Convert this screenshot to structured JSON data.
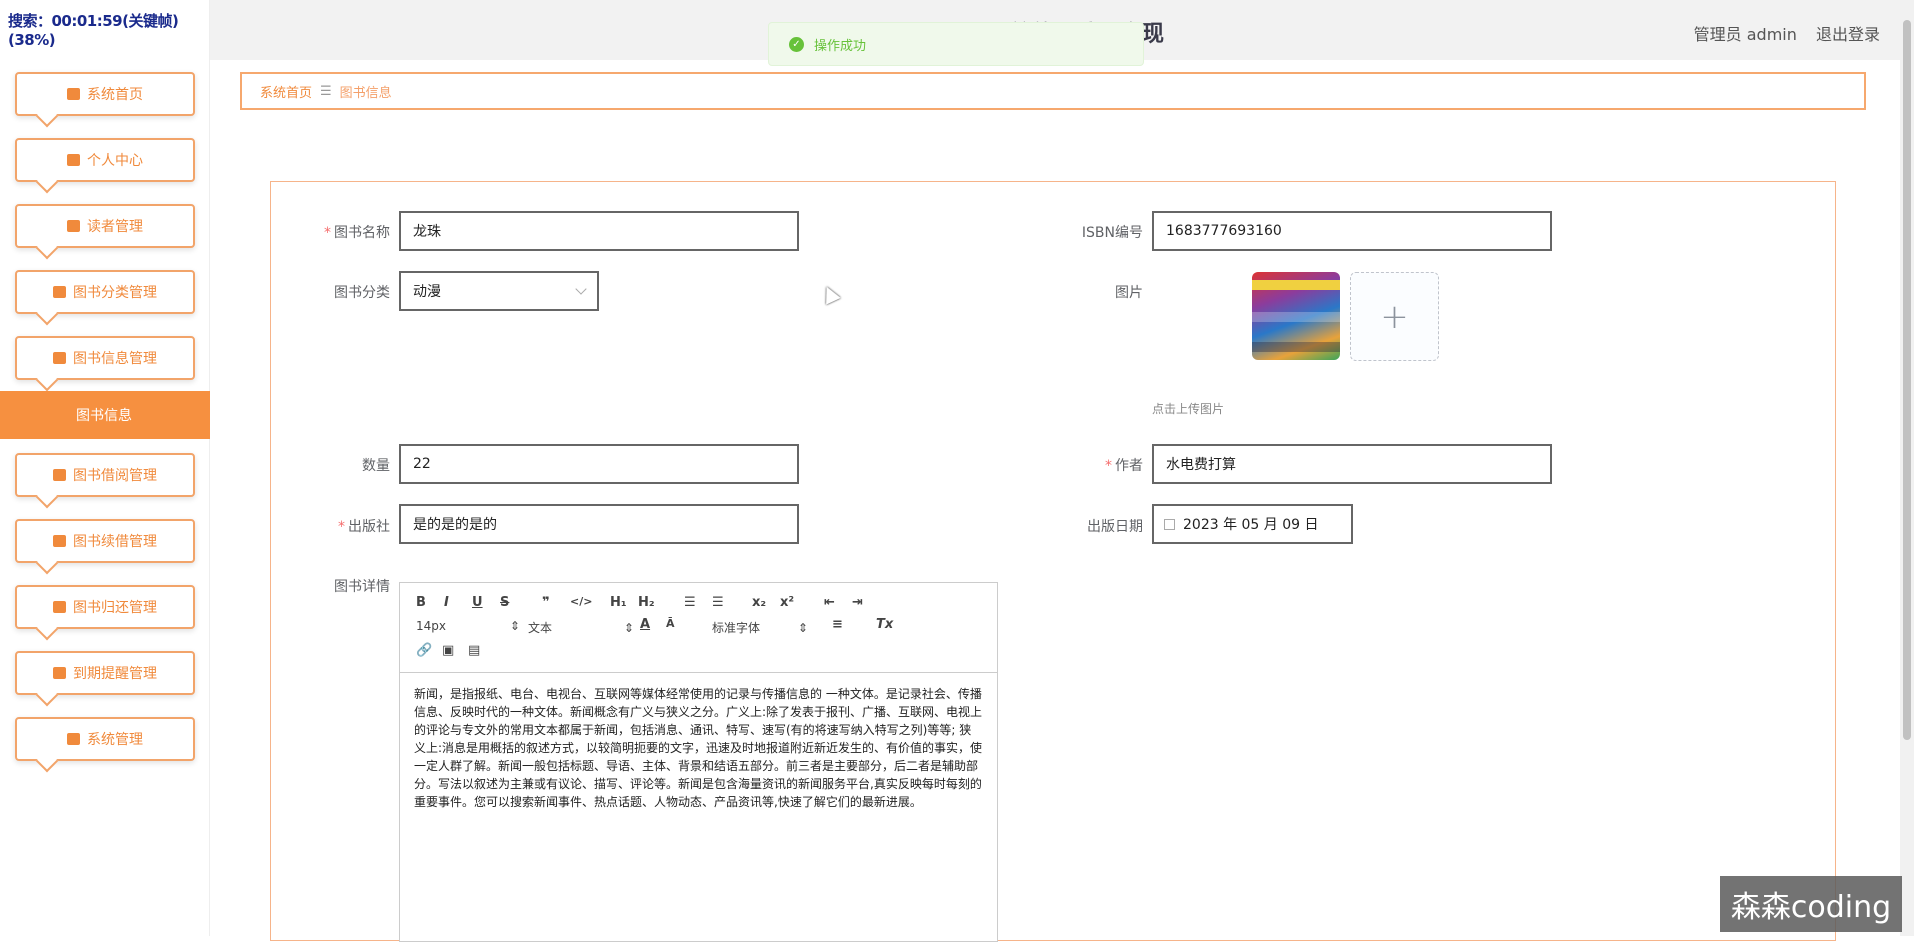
{
  "recording": "搜索：00:01:59(关键帧)(38%)",
  "header": {
    "title": "统的设计与实现",
    "user": "管理员 admin",
    "logout": "退出登录"
  },
  "toast": "操作成功",
  "breadcrumb": {
    "home": "系统首页",
    "sep": "☰",
    "current": "图书信息"
  },
  "sidebar": {
    "items": [
      {
        "label": "系统首页"
      },
      {
        "label": "个人中心"
      },
      {
        "label": "读者管理"
      },
      {
        "label": "图书分类管理"
      },
      {
        "label": "图书信息管理"
      },
      {
        "label": "图书借阅管理"
      },
      {
        "label": "图书续借管理"
      },
      {
        "label": "图书归还管理"
      },
      {
        "label": "到期提醒管理"
      },
      {
        "label": "系统管理"
      }
    ],
    "active": "图书信息"
  },
  "form": {
    "name_label": "图书名称",
    "name_value": "龙珠",
    "isbn_label": "ISBN编号",
    "isbn_value": "1683777693160",
    "category_label": "图书分类",
    "category_value": "动漫",
    "image_label": "图片",
    "image_hint": "点击上传图片",
    "quantity_label": "数量",
    "quantity_value": "22",
    "author_label": "作者",
    "author_value": "水电费打算",
    "publisher_label": "出版社",
    "publisher_value": "是的是的是的",
    "date_label": "出版日期",
    "date_value": "2023 年 05 月 09 日",
    "detail_label": "图书详情"
  },
  "editor": {
    "font_size": "14px",
    "paragraph": "文本",
    "font_family": "标准字体",
    "content": "新闻，是指报纸、电台、电视台、互联网等媒体经常使用的记录与传播信息的 一种文体。是记录社会、传播信息、反映时代的一种文体。新闻概念有广义与狭义之分。广义上:除了发表于报刊、广播、互联网、电视上的评论与专文外的常用文本都属于新闻，包括消息、通讯、特写、速写(有的将速写纳入特写之列)等等; 狭义上:消息是用概括的叙述方式，以较简明扼要的文字，迅速及时地报道附近新近发生的、有价值的事实，使一定人群了解。新闻一般包括标题、导语、主体、背景和结语五部分。前三者是主要部分，后二者是辅助部分。写法以叙述为主兼或有议论、描写、评论等。新闻是包含海量资讯的新闻服务平台,真实反映每时每刻的重要事件。您可以搜索新闻事件、热点话题、人物动态、产品资讯等,快速了解它们的最新进展。"
  },
  "watermark": "森森coding"
}
